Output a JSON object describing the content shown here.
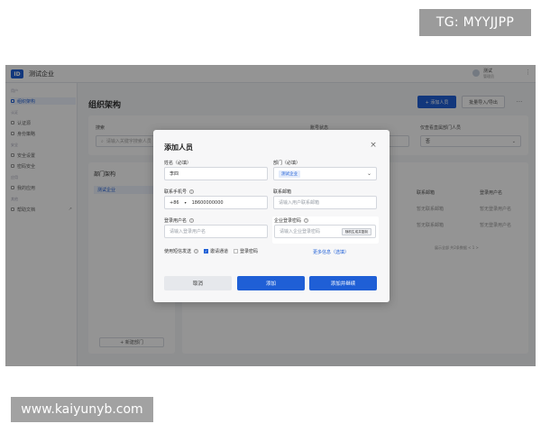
{
  "watermarks": {
    "tg": "TG: MYYJJPP",
    "url": "www.kaiyunyb.com"
  },
  "app": {
    "name": "测试企业",
    "logo_text": "ID",
    "user": {
      "name": "测试",
      "role": "管理员"
    },
    "more_icon": "more-dots-icon"
  },
  "sidebar": {
    "groups": [
      {
        "label": "用户",
        "items": [
          {
            "label": "组织架构",
            "active": true
          }
        ]
      },
      {
        "label": "认证",
        "items": [
          {
            "label": "认证源",
            "active": false
          },
          {
            "label": "身份策略",
            "active": false
          }
        ]
      },
      {
        "label": "安全",
        "items": [
          {
            "label": "安全设置",
            "active": false
          },
          {
            "label": "密码安全",
            "active": false
          }
        ]
      },
      {
        "label": "应用",
        "items": [
          {
            "label": "我的应用",
            "active": false
          }
        ]
      },
      {
        "label": "其他",
        "items": [
          {
            "label": "帮助文档",
            "active": false
          }
        ]
      }
    ],
    "external_icon": "↗"
  },
  "main": {
    "title": "组织架构",
    "add_member_label": "+ 添加人员",
    "import_label": "批量导入/导出",
    "more_label": "···",
    "filters": {
      "search_label": "搜索",
      "search_placeholder": "请输入关键字搜索人员",
      "status_label": "账号状态",
      "include_label": "仅查看直属部门人员",
      "include_value": "否"
    },
    "dept_tree": {
      "title": "部门架构",
      "root": "测试企业",
      "add_label": "+ 新建部门"
    },
    "table": {
      "headers": [
        "联系邮箱",
        "登录用户名"
      ],
      "rows": [
        [
          "暂无联系邮箱",
          "暂无登录用户名"
        ],
        [
          "暂无联系邮箱",
          "暂无登录用户名"
        ]
      ],
      "pager": "展示全部 共2条数据 < 1 >"
    }
  },
  "modal": {
    "title": "添加人员",
    "close_label": "×",
    "fields": {
      "name_label": "姓名（必填）",
      "name_value": "李四",
      "dept_label": "部门（必填）",
      "dept_value": "测试企业",
      "phone_label": "联系手机号",
      "phone_prefix": "+86",
      "phone_value": "18600000000",
      "email_label": "联系邮箱",
      "email_placeholder": "请输入用户联系邮箱",
      "username_label": "登录用户名",
      "username_placeholder": "请输入登录用户名",
      "password_label": "企业登录密码",
      "password_placeholder": "请输入企业登录密码",
      "generate_label": "随机生成并复制"
    },
    "notify": {
      "label": "使用短信发送",
      "options": [
        {
          "label": "邀请通道",
          "checked": true
        },
        {
          "label": "登录密码",
          "checked": false
        }
      ]
    },
    "more_info": "更多信息（选填）",
    "buttons": {
      "cancel": "取消",
      "add": "添加",
      "add_continue": "添加并继续"
    }
  }
}
